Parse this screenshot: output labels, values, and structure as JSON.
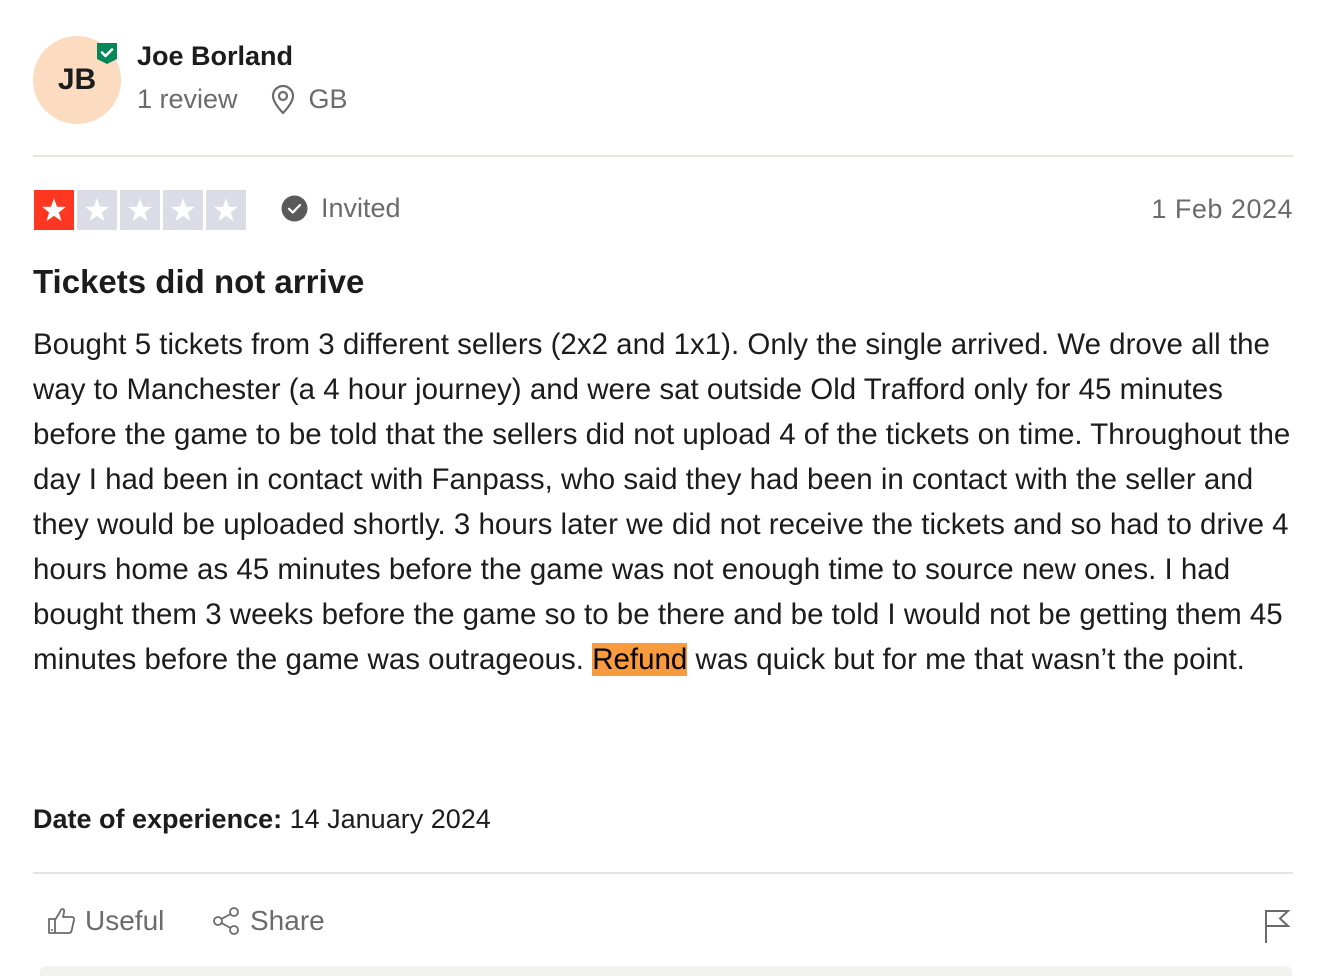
{
  "consumer": {
    "initials": "JB",
    "name": "Joe Borland",
    "review_count": "1 review",
    "location": "GB",
    "verified": true,
    "avatar_color": "#fbdcc0",
    "badge_color": "#04885a"
  },
  "review": {
    "rating": 1,
    "max_rating": 5,
    "star_active_color": "#ff3722",
    "star_inactive_color": "#dcdce6",
    "status_label": "Invited",
    "date": "1 Feb 2024",
    "title": "Tickets did not arrive",
    "body_before": "Bought 5 tickets from 3 different sellers (2x2 and 1x1). Only the single arrived. We drove all the way to Manchester (a 4 hour journey) and were sat outside Old Trafford only for 45 minutes before the game to be told that the sellers did not upload 4 of the tickets on time. Throughout the day I had been in contact with Fanpass, who said they had been in contact with the seller and they would be uploaded shortly. 3 hours later we did not receive the tickets and so had to drive 4 hours home as 45 minutes before the game was not enough time to source new ones. I had bought them 3 weeks before the game so to be there and be told I would not be getting them 45 minutes before the game was outrageous. ",
    "body_highlight": "Refund",
    "body_after": " was quick but for me that wasn’t the point.",
    "highlight_color": "#f89a3e",
    "experience_label": "Date of experience:",
    "experience_date": "14 January 2024"
  },
  "actions": {
    "useful_label": "Useful",
    "share_label": "Share",
    "report_icon": "flag-icon"
  },
  "icons": {
    "verified": "shield-check-icon",
    "location": "map-pin-icon",
    "invited": "check-circle-icon",
    "useful": "thumbs-up-icon",
    "share": "share-icon",
    "star": "star-icon"
  }
}
